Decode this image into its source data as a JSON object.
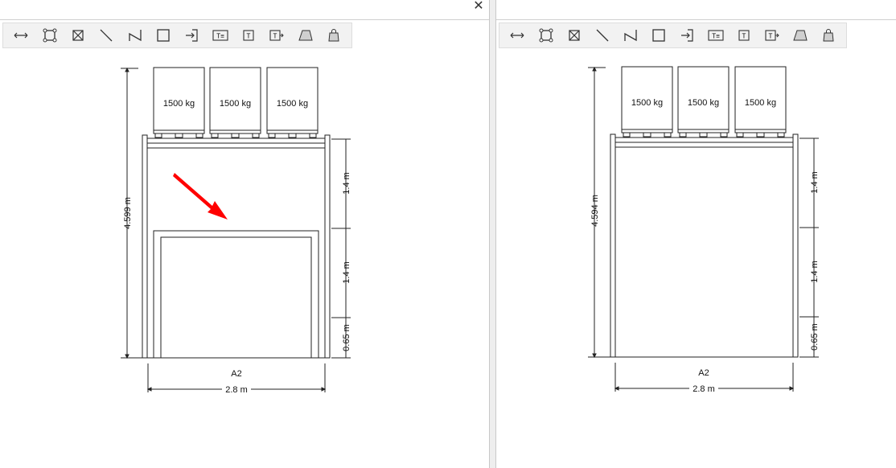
{
  "window": {
    "close_label": "✕"
  },
  "toolbar": {
    "tools": [
      {
        "icon": "dimension-horizontal-icon"
      },
      {
        "icon": "select-frame-icon"
      },
      {
        "icon": "delete-icon"
      },
      {
        "icon": "line-icon"
      },
      {
        "icon": "polyline-icon"
      },
      {
        "icon": "rectangle-icon"
      },
      {
        "icon": "insert-icon"
      },
      {
        "icon": "text-box-icon",
        "label": "T≡"
      },
      {
        "icon": "text-icon",
        "label": "T"
      },
      {
        "icon": "text-arrow-icon",
        "label": "T"
      },
      {
        "icon": "trapezoid-icon"
      },
      {
        "icon": "bag-icon"
      }
    ]
  },
  "left_drawing": {
    "loads": [
      "1500 kg",
      "1500 kg",
      "1500 kg"
    ],
    "height_dim": "4.599 m",
    "level_dims": [
      "1.4 m",
      "1.4 m",
      "0.65 m"
    ],
    "bay_name": "A2",
    "width_dim": "2.8 m",
    "arrow_color": "#ff0000"
  },
  "right_drawing": {
    "loads": [
      "1500 kg",
      "1500 kg",
      "1500 kg"
    ],
    "height_dim": "4.594 m",
    "level_dims": [
      "1.4 m",
      "1.4 m",
      "0.65 m"
    ],
    "bay_name": "A2",
    "width_dim": "2.8 m"
  }
}
